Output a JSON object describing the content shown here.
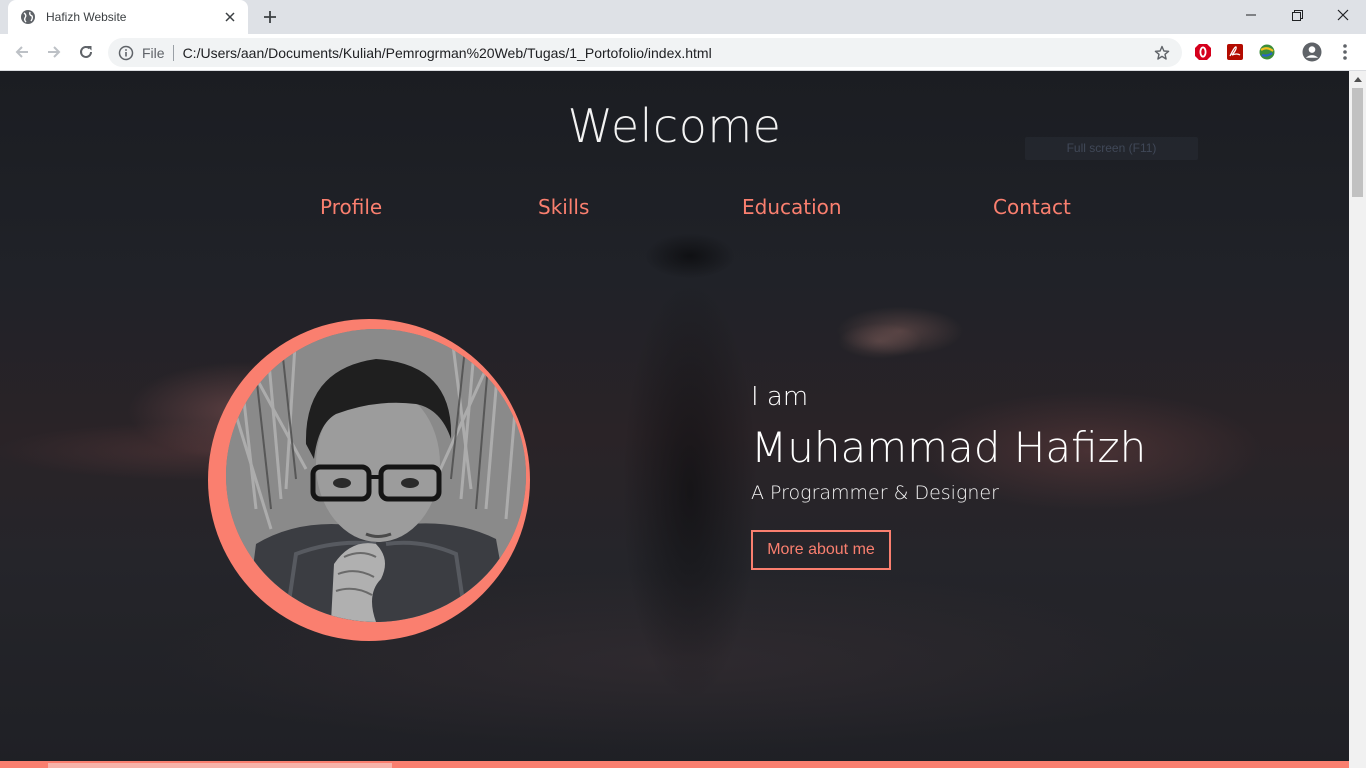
{
  "browser": {
    "tab_title": "Hafizh Website",
    "url_scheme_label": "File",
    "url": "C:/Users/aan/Documents/Kuliah/Pemrogrman%20Web/Tugas/1_Portofolio/index.html"
  },
  "page": {
    "title": "Welcome",
    "tooltip_ghost": "Full screen (F11)",
    "nav": [
      "Profile",
      "Skills",
      "Education",
      "Contact"
    ],
    "intro": "I am",
    "name": "Muhammad Hafizh",
    "role": "A Programmer & Designer",
    "cta_label": "More about me"
  },
  "colors": {
    "accent": "#fa7f6f",
    "background": "#1b1c20"
  }
}
